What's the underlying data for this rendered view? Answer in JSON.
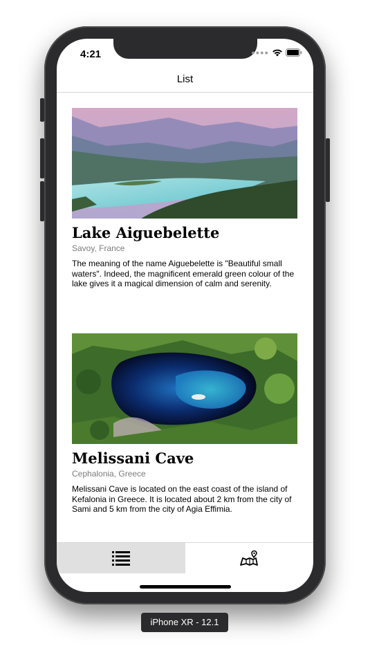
{
  "status_bar": {
    "time": "4:21"
  },
  "navbar": {
    "title": "List"
  },
  "places": [
    {
      "name": "Lake Aiguebelette",
      "location": "Savoy, France",
      "description": "The meaning of the name Aiguebelette is \"Beautiful small waters\". Indeed, the magnificent emerald green colour of the lake gives it a magical dimension of calm and serenity."
    },
    {
      "name": "Melissani Cave",
      "location": "Cephalonia, Greece",
      "description": "Melissani Cave is located on the east coast of the island of Kefalonia in Greece. It is located about 2 km from the city of Sami and 5 km from the city of Agia Effimia."
    }
  ],
  "tab_bar": {
    "tabs": [
      {
        "icon": "list-icon",
        "active": true
      },
      {
        "icon": "map-icon",
        "active": false
      }
    ]
  },
  "device_label": "iPhone XR - 12.1",
  "colors": {
    "tab_active_bg": "#e0e0e0",
    "phone_frame": "#2b2b2d",
    "subtitle_text": "#7b7b7b"
  }
}
